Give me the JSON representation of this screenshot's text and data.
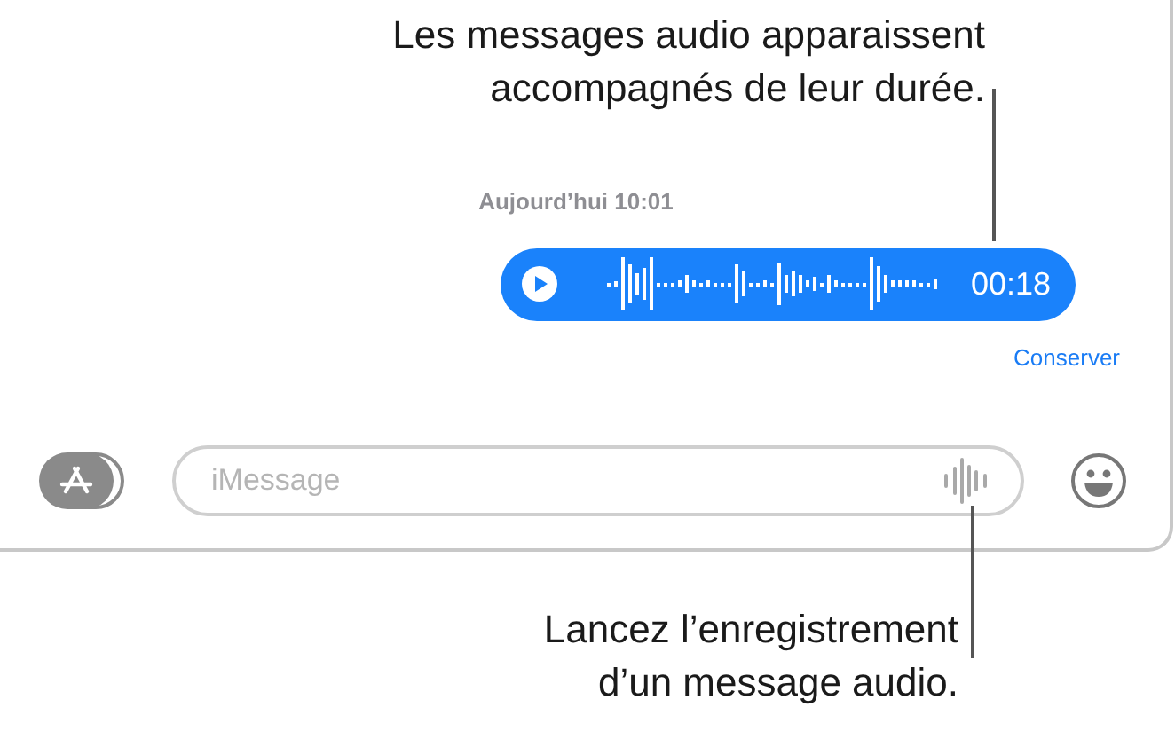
{
  "callouts": [
    {
      "lines": [
        "Les messages audio apparaissent",
        "accompagnés de leur durée."
      ]
    },
    {
      "lines": [
        "Lancez l’enregistrement",
        "d’un message audio."
      ]
    }
  ],
  "timestamp": "Aujourd’hui 10:01",
  "message": {
    "duration": "00:18",
    "action": "Conserver"
  },
  "input": {
    "placeholder": "iMessage"
  }
}
